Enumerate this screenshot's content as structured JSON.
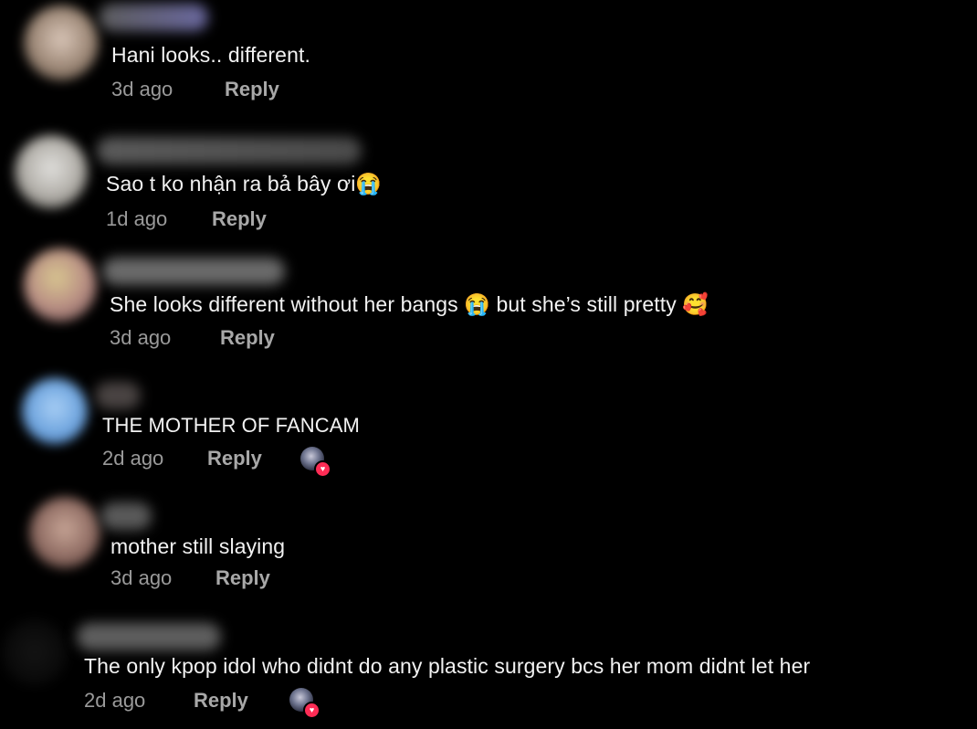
{
  "comments": [
    {
      "text": "Hani looks.. different.",
      "time": "3d ago",
      "reply": "Reply"
    },
    {
      "text": "Sao t ko nhận ra bả bây ơi😭",
      "time": "1d ago",
      "reply": "Reply"
    },
    {
      "text": "She looks different without her bangs 😭 but she’s still pretty 🥰",
      "time": "3d ago",
      "reply": "Reply"
    },
    {
      "text": "THE MOTHER OF FANCAM",
      "time": "2d ago",
      "reply": "Reply",
      "creator_liked_icon": "heart-icon"
    },
    {
      "text": "mother still slaying",
      "time": "3d ago",
      "reply": "Reply"
    },
    {
      "text": "The only kpop idol who didnt do any plastic surgery bcs her mom didnt let her",
      "time": "2d ago",
      "reply": "Reply",
      "creator_liked_icon": "heart-icon"
    }
  ],
  "colors": {
    "background": "#000000",
    "text": "#f2f2f2",
    "meta": "#9a9a9a",
    "heart": "#fe2c55"
  }
}
